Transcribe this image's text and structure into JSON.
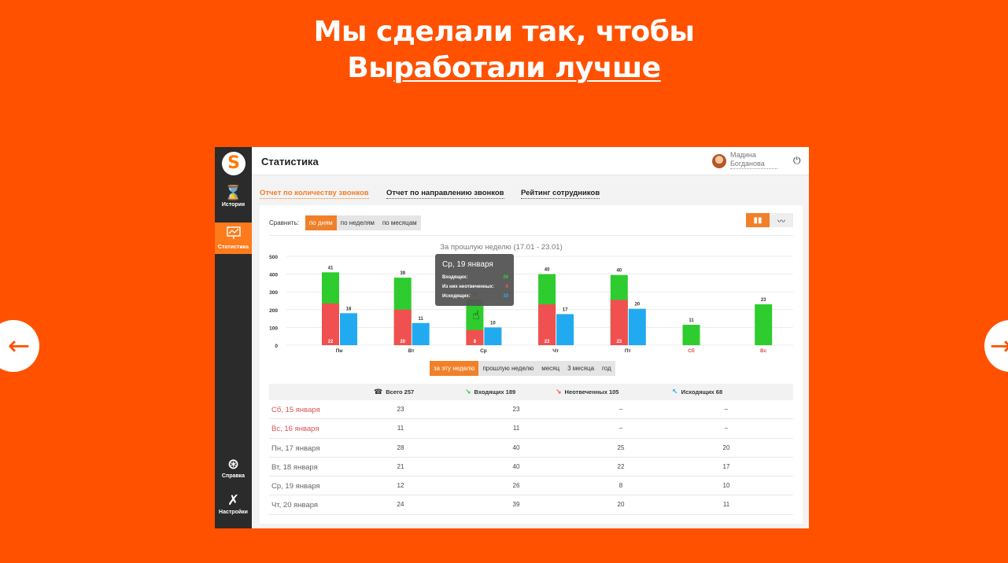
{
  "hero": {
    "line1": "Мы сделали так, чтобы",
    "line2_plain": "Вы",
    "line2_underlined": "работали лучше"
  },
  "nav": {
    "prev_icon": "arrow-left-icon",
    "next_icon": "arrow-right-icon"
  },
  "colors": {
    "brand": "#ff5100",
    "accent": "#f0802a",
    "incoming": "#2ecc2e",
    "missed": "#f05050",
    "outgoing": "#22aaf0"
  },
  "app": {
    "logo": "S",
    "sidebar": [
      {
        "label": "История",
        "icon": "hourglass-icon"
      },
      {
        "label": "Статистика",
        "icon": "chart-monitor-icon",
        "active": true
      },
      {
        "label": "Справка",
        "icon": "lifebuoy-icon"
      },
      {
        "label": "Настройки",
        "icon": "tools-icon"
      }
    ],
    "title": "Статистика",
    "user": {
      "first": "Мадина",
      "last": "Богданова"
    },
    "tabs": [
      "Отчет по количеству звонков",
      "Отчет по направлению звонков",
      "Рейтинг сотрудников"
    ],
    "compare": {
      "label": "Сравнить:",
      "options": [
        "по дням",
        "по неделям",
        "по месяцам"
      ],
      "selected": "по дням"
    },
    "periods": [
      "за эту неделю",
      "прошлую неделю",
      "месяц",
      "3 месяца",
      "год"
    ],
    "tooltip": {
      "title": "Ср, 19 января",
      "rows": [
        {
          "label": "Входящих:",
          "value": "26"
        },
        {
          "label": "Из них неотвеченных:",
          "value": "8"
        },
        {
          "label": "Исходящих:",
          "value": "10"
        }
      ]
    },
    "table": {
      "headers": [
        "Всего 257",
        "Входящих 189",
        "Неотвеченных 105",
        "Исходящих 68"
      ],
      "rows": [
        {
          "day": "Сб, 15 января",
          "weekend": true,
          "total": "23",
          "incoming": "23",
          "missed": "–",
          "outgoing": "–"
        },
        {
          "day": "Вс, 16 января",
          "weekend": true,
          "total": "11",
          "incoming": "11",
          "missed": "–",
          "outgoing": "–"
        },
        {
          "day": "Пн, 17 января",
          "weekend": false,
          "total": "28",
          "incoming": "40",
          "missed": "25",
          "outgoing": "20"
        },
        {
          "day": "Вт, 18 января",
          "weekend": false,
          "total": "21",
          "incoming": "40",
          "missed": "22",
          "outgoing": "17"
        },
        {
          "day": "Ср, 19 января",
          "weekend": false,
          "total": "12",
          "incoming": "26",
          "missed": "8",
          "outgoing": "10"
        },
        {
          "day": "Чт, 20 января",
          "weekend": false,
          "total": "24",
          "incoming": "39",
          "missed": "20",
          "outgoing": "11"
        }
      ]
    }
  },
  "chart_data": {
    "type": "bar",
    "title": "За прошлую неделю (17.01 - 23.01)",
    "categories": [
      "Пн",
      "Вт",
      "Ср",
      "Чт",
      "Пт",
      "Сб",
      "Вс"
    ],
    "weekend_categories": [
      "Сб",
      "Вс"
    ],
    "ylim": [
      0,
      500
    ],
    "yticks": [
      0,
      100,
      200,
      300,
      400,
      500
    ],
    "series": [
      {
        "name": "Входящих",
        "color": "#2ecc2e",
        "values": [
          410,
          380,
          260,
          400,
          395,
          115,
          230
        ],
        "labels": [
          "41",
          "39",
          "26",
          "40",
          "40",
          "11",
          "23"
        ]
      },
      {
        "name": "Неотвеченных",
        "color": "#f05050",
        "values": [
          235,
          200,
          85,
          230,
          255,
          0,
          0
        ],
        "labels": [
          "22",
          "20",
          "8",
          "22",
          "23",
          "",
          ""
        ]
      },
      {
        "name": "Исходящих",
        "color": "#22aaf0",
        "values": [
          180,
          125,
          100,
          175,
          205,
          0,
          0
        ],
        "labels": [
          "18",
          "11",
          "10",
          "17",
          "20",
          "",
          ""
        ]
      }
    ]
  }
}
